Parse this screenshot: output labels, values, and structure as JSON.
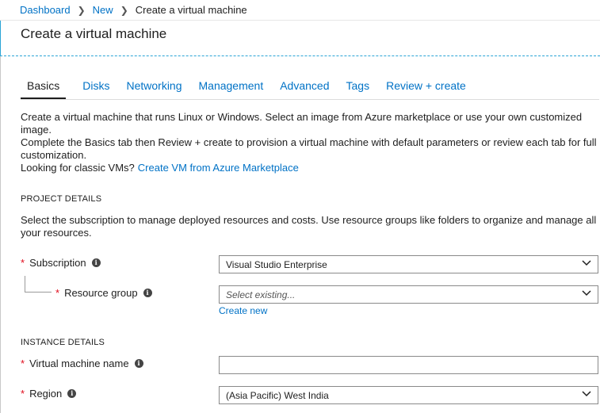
{
  "breadcrumb": {
    "items": [
      "Dashboard",
      "New"
    ],
    "current": "Create a virtual machine"
  },
  "page_title": "Create a virtual machine",
  "tabs": [
    "Basics",
    "Disks",
    "Networking",
    "Management",
    "Advanced",
    "Tags",
    "Review + create"
  ],
  "intro": {
    "line1": "Create a virtual machine that runs Linux or Windows. Select an image from Azure marketplace or use your own customized image.",
    "line2": "Complete the Basics tab then Review + create to provision a virtual machine with default parameters or review each tab for full customization.",
    "classic_prefix": "Looking for classic VMs?",
    "classic_link": "Create VM from Azure Marketplace"
  },
  "project_details": {
    "heading": "PROJECT DETAILS",
    "description": "Select the subscription to manage deployed resources and costs. Use resource groups like folders to organize and manage all your resources.",
    "subscription_label": "Subscription",
    "subscription_value": "Visual Studio Enterprise",
    "resource_group_label": "Resource group",
    "resource_group_placeholder": "Select existing...",
    "create_new": "Create new"
  },
  "instance_details": {
    "heading": "INSTANCE DETAILS",
    "vm_name_label": "Virtual machine name",
    "vm_name_value": "",
    "region_label": "Region",
    "region_value": "(Asia Pacific) West India"
  },
  "required_marker": "*",
  "info_glyph": "i",
  "icons": {
    "breadcrumb_separator": "chevron-right-icon",
    "dropdown": "chevron-down-icon",
    "info": "info-icon"
  },
  "colors": {
    "link": "#0072c6",
    "required": "#e00b1c",
    "accent_border": "#2aa4d6"
  }
}
